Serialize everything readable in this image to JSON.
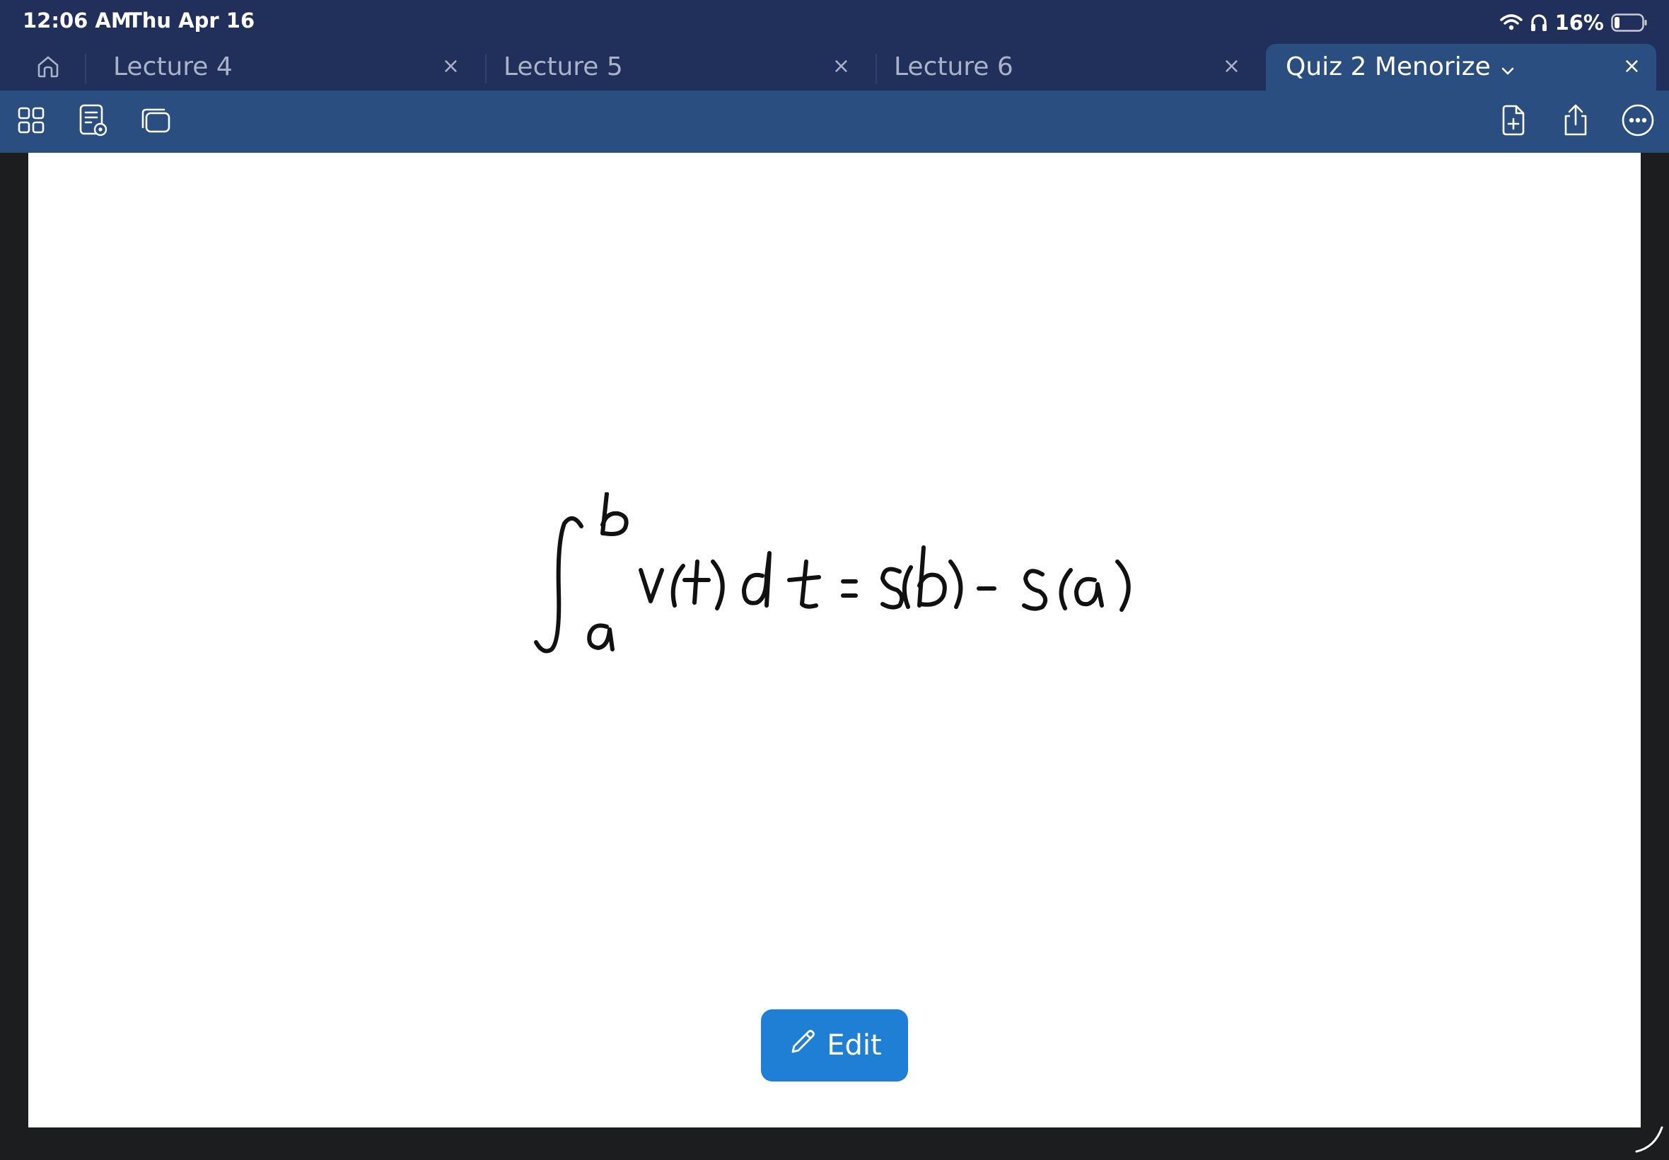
{
  "status_bar": {
    "time": "12:06 AM",
    "date": "Thu Apr 16",
    "battery": "16%"
  },
  "tabs": [
    {
      "label": "Lecture 4",
      "close": "×"
    },
    {
      "label": "Lecture 5",
      "close": "×"
    },
    {
      "label": "Lecture 6",
      "close": "×"
    },
    {
      "label": "Quiz 2 Menorize",
      "close": "×",
      "active": true
    }
  ],
  "toolbar": {
    "left_icons": [
      "grid-icon",
      "document-view-icon",
      "pages-stack-icon"
    ],
    "right_icons": [
      "add-page-icon",
      "share-icon",
      "more-icon"
    ]
  },
  "page": {
    "handwriting": "∫ₐᵇ v(t) dt = s(b) - s(a)"
  },
  "edit_button": {
    "label": "Edit"
  },
  "colors": {
    "status_bg": "#21305a",
    "toolbar_bg": "#2a4e80",
    "edit_button": "#1f7fd4",
    "outer_bg": "#1c1d1f"
  }
}
